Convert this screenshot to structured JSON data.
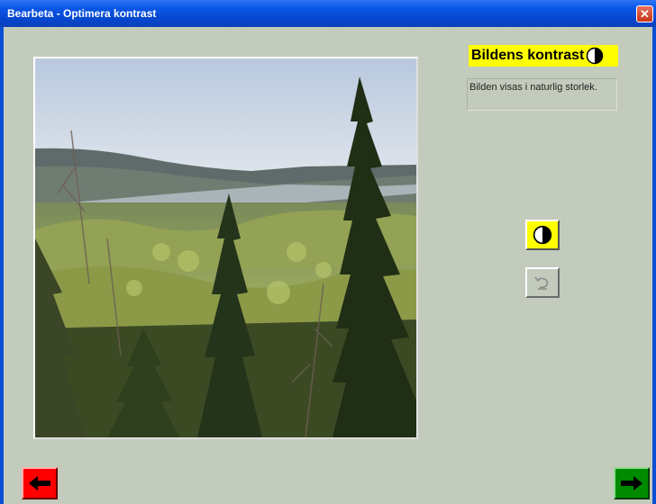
{
  "window": {
    "title": "Bearbeta - Optimera kontrast",
    "close_symbol": "✕"
  },
  "panel": {
    "heading": "Bildens kontrast",
    "heading_icon": "contrast-icon",
    "info_text": "Bilden visas i naturlig storlek."
  },
  "tools": {
    "contrast_icon": "contrast-icon",
    "undo_icon": "undo-icon"
  },
  "navigation": {
    "back_icon": "arrow-left-icon",
    "next_icon": "arrow-right-icon"
  },
  "colors": {
    "background": "#c3cbbc",
    "highlight": "#ffff00",
    "back": "#ff0000",
    "next": "#008a00",
    "titlebar": "#0a56e6"
  }
}
